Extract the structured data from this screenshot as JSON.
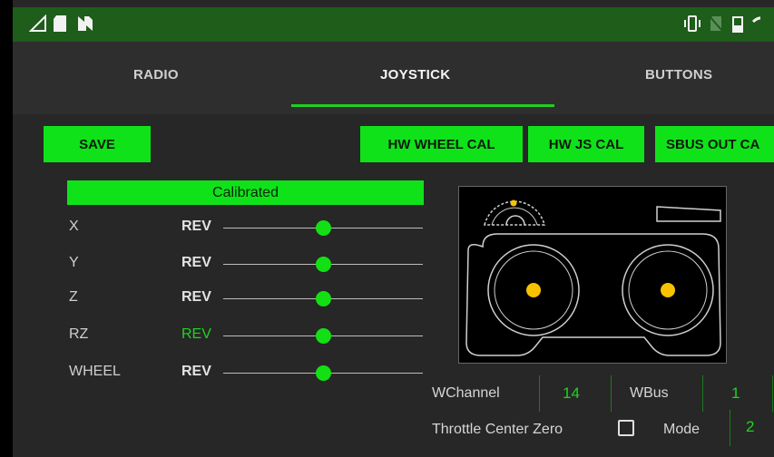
{
  "tabs": [
    {
      "label": "RADIO",
      "active": false
    },
    {
      "label": "JOYSTICK",
      "active": true
    },
    {
      "label": "BUTTONS",
      "active": false
    }
  ],
  "buttons": {
    "save": "SAVE",
    "hw_wheel_cal": "HW WHEEL CAL",
    "hw_js_cal": "HW JS CAL",
    "sbus_out_cal": "SBUS OUT CA"
  },
  "calibration_status": "Calibrated",
  "axes": [
    {
      "label": "X",
      "rev_label": "REV",
      "rev_active": false,
      "value": 0.5
    },
    {
      "label": "Y",
      "rev_label": "REV",
      "rev_active": false,
      "value": 0.5
    },
    {
      "label": "Z",
      "rev_label": "REV",
      "rev_active": false,
      "value": 0.5
    },
    {
      "label": "RZ",
      "rev_label": "REV",
      "rev_active": true,
      "value": 0.5
    },
    {
      "label": "WHEEL",
      "rev_label": "REV",
      "rev_active": false,
      "value": 0.5
    }
  ],
  "settings": {
    "wchannel_label": "WChannel",
    "wchannel_value": "14",
    "wbus_label": "WBus",
    "wbus_value": "1",
    "throttle_center_zero_label": "Throttle Center Zero",
    "throttle_center_zero_checked": false,
    "mode_label": "Mode",
    "mode_value": "2"
  },
  "colors": {
    "accent": "#10e21a",
    "status_bar": "#1e5d1a",
    "background": "#272727",
    "stick_dot": "#f7c200"
  }
}
